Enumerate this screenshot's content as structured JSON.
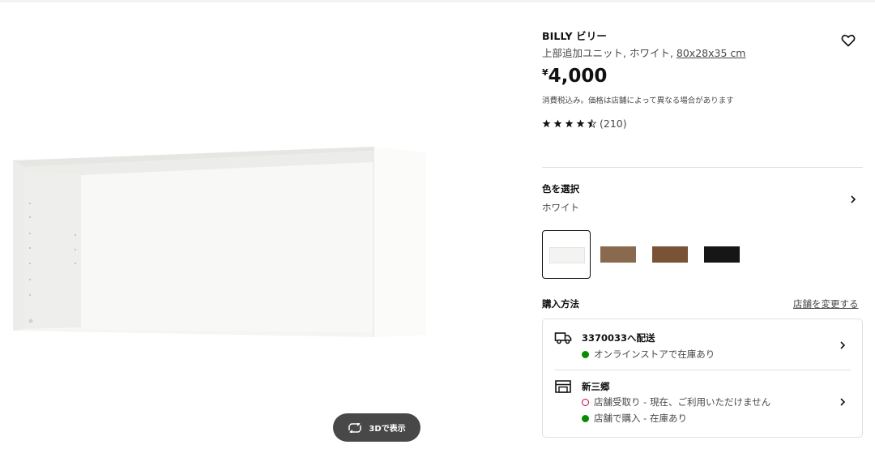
{
  "colors": {
    "ink": "#111111",
    "muted": "#484848",
    "available": "#0a8a00",
    "unavailable": "#cc0044",
    "button_dark": "#484848"
  },
  "gallery": {
    "view_3d_label": "3Dで表示",
    "view_3d_icon": "rotate-3d-icon"
  },
  "product": {
    "name": "BILLY ビリー",
    "description_prefix": "上部追加ユニット, ホワイト, ",
    "dimensions": "80x28x35 cm",
    "favorite_icon": "heart-icon",
    "price_currency": "¥",
    "price_amount": "4,000",
    "tax_note": "消費税込み。価格は店舗によって異なる場合があります",
    "rating_stars": 4.5,
    "review_count": "(210)"
  },
  "color_selector": {
    "label": "色を選択",
    "value": "ホワイト",
    "swatches": [
      {
        "name": "white",
        "color": "#f3f3f1",
        "selected": true
      },
      {
        "name": "oak-effect",
        "color": "#8a6a4e",
        "selected": false
      },
      {
        "name": "brown-walnut",
        "color": "#7a5236",
        "selected": false
      },
      {
        "name": "black",
        "color": "#161616",
        "selected": false
      }
    ]
  },
  "purchase": {
    "label": "購入方法",
    "change_store": "店舗を変更する",
    "delivery": {
      "icon": "truck-icon",
      "title": "3370033へ配送",
      "status": "オンラインストアで在庫あり"
    },
    "store": {
      "icon": "store-icon",
      "title": "新三郷",
      "pickup": "店舗受取り - 現在、ご利用いただけません",
      "instore": "店舗で購入 - 在庫あり"
    }
  }
}
